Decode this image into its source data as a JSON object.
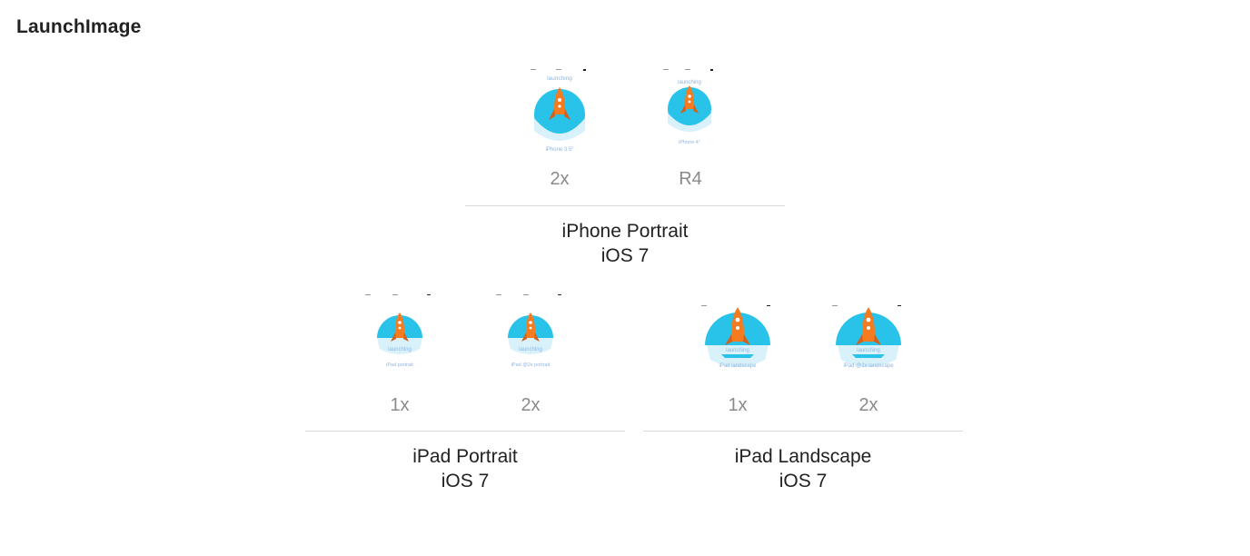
{
  "page_title": "LaunchImage",
  "groups": {
    "iphone_portrait": {
      "title": "iPhone Portrait",
      "subtitle": "iOS 7",
      "slots": [
        {
          "scale": "2x",
          "thumb_caption": "launching",
          "thumb_footer": "iPhone 3.5\""
        },
        {
          "scale": "R4",
          "thumb_caption": "launching",
          "thumb_footer": "iPhone 4\""
        }
      ]
    },
    "ipad_portrait": {
      "title": "iPad Portrait",
      "subtitle": "iOS 7",
      "slots": [
        {
          "scale": "1x",
          "thumb_caption": "launching",
          "thumb_footer": "iPad portrait"
        },
        {
          "scale": "2x",
          "thumb_caption": "launching",
          "thumb_footer": "iPad @2x portrait"
        }
      ]
    },
    "ipad_landscape": {
      "title": "iPad Landscape",
      "subtitle": "iOS 7",
      "slots": [
        {
          "scale": "1x",
          "thumb_caption": "launching",
          "thumb_footer": "iPad landscape"
        },
        {
          "scale": "2x",
          "thumb_caption": "launching",
          "thumb_footer": "iPad @2x landscape"
        }
      ]
    }
  },
  "colors": {
    "circle": "#29c3ea",
    "circle_light": "#d8f1fa",
    "rocket": "#f47b20",
    "rocket_dark": "#d4601a",
    "thumb_text": "#8fb6e0"
  }
}
